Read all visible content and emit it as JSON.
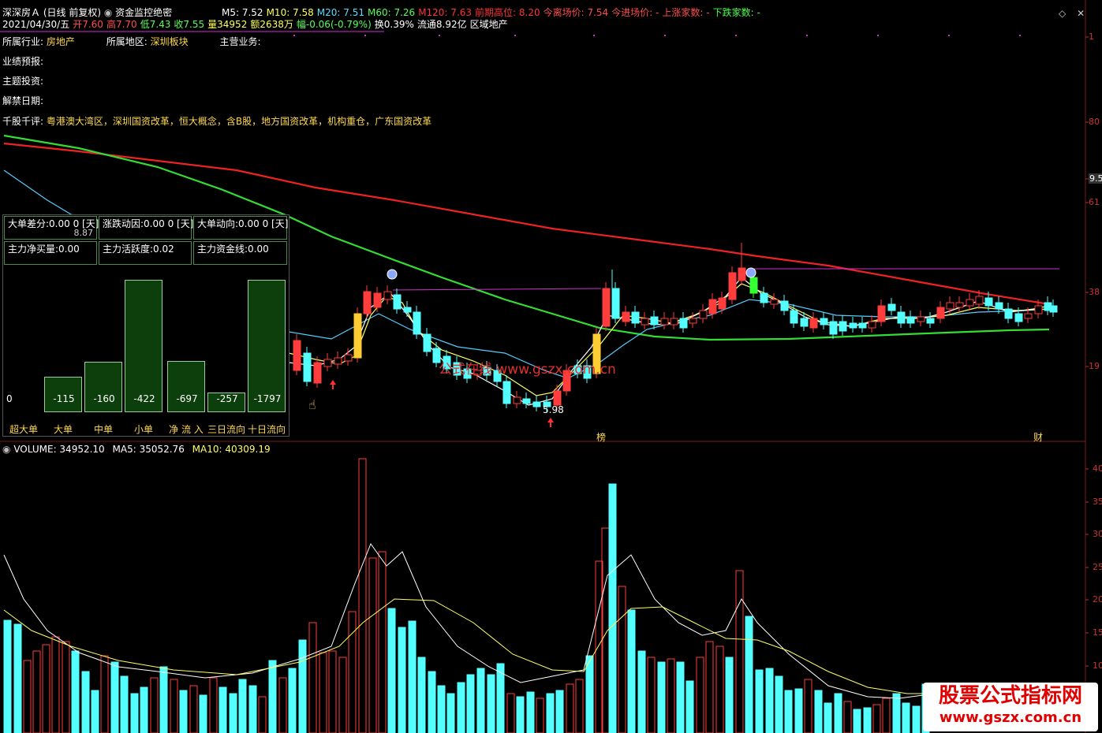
{
  "header": {
    "stock_name": "深深房Ａ",
    "mode": "(日线 前复权)",
    "indicator": "资金监控绝密",
    "ma": [
      {
        "label": "M5: 7.52",
        "color": "#ffffff"
      },
      {
        "label": "M10: 7.58",
        "color": "#ffff55"
      },
      {
        "label": "M20: 7.51",
        "color": "#55ddff"
      },
      {
        "label": "M60: 7.26",
        "color": "#55ff55"
      },
      {
        "label": "M120: 7.63",
        "color": "#ff3333"
      },
      {
        "label": "前期高位: 8.20",
        "color": "#ff3333"
      },
      {
        "label": "今离场价: 7.54",
        "color": "#ff4d4d"
      },
      {
        "label": "今进场价: -",
        "color": "#ff4d4d"
      },
      {
        "label": "上涨家数: -",
        "color": "#ff4d4d"
      },
      {
        "label": "下跌家数: -",
        "color": "#44ff44"
      }
    ],
    "quote": [
      {
        "label": "2021/04/30/五",
        "color": "#ffffff"
      },
      {
        "label": "开7.60",
        "color": "#ff4d4d"
      },
      {
        "label": "高7.70",
        "color": "#ff4d4d"
      },
      {
        "label": "低7.43",
        "color": "#55ff55"
      },
      {
        "label": "收7.55",
        "color": "#55ff55"
      },
      {
        "label": "量34952",
        "color": "#ffff55"
      },
      {
        "label": "额2638万",
        "color": "#ffff55"
      },
      {
        "label": "幅-0.06(-0.79%)",
        "color": "#55ff55"
      },
      {
        "label": "换0.39%",
        "color": "#ffffff"
      },
      {
        "label": "流通8.92亿",
        "color": "#ffffff"
      },
      {
        "label": "区域地产",
        "color": "#ffffff"
      }
    ]
  },
  "info": {
    "industry_label": "所属行业:",
    "industry": "房地产",
    "region_label": "所属地区:",
    "region": "深圳板块",
    "business_label": "主营业务:",
    "forecast_label": "业绩预报:",
    "theme_label": "主题投资:",
    "unlock_label": "解禁日期:",
    "comment_label": "千股千评:",
    "comment": "粤港澳大湾区，深圳国资改革，恒大概念，含B股，地方国资改革，机构重仓，广东国资改革"
  },
  "panel": {
    "cells": [
      "大单差分:0.00    0 [天]",
      "涨跌动因:0.00  0 [天]",
      "大单动向:0.00   0 [天]",
      "主力净买量:0.00",
      "主力活跃度:0.02",
      "主力资金线:0.00"
    ],
    "price_note": "8.87",
    "bars": [
      {
        "label": "超大单",
        "value": "0",
        "height": 0
      },
      {
        "label": "大单",
        "value": "-115",
        "height": 45
      },
      {
        "label": "中单",
        "value": "-160",
        "height": 64
      },
      {
        "label": "小单",
        "value": "-422",
        "height": 168
      },
      {
        "label": "净 流 入",
        "value": "-697",
        "height": 65
      },
      {
        "label": "三日流向",
        "value": "-257",
        "height": 25
      },
      {
        "label": "十日流向",
        "value": "-1797",
        "height": 168
      }
    ]
  },
  "chart_annotations": {
    "low_label": "5.98",
    "tag_bang": "榜",
    "tag_cai": "财"
  },
  "right_axis": {
    "top": [
      "1",
      "80",
      "9.51",
      "61",
      "38",
      "19"
    ],
    "bottom": [
      "40",
      "35",
      "30",
      "25",
      "20",
      "15",
      "10"
    ]
  },
  "volume": {
    "label": "VOLUME: 34952.10",
    "ma5": "MA5: 35052.76",
    "ma10": "MA10: 40309.19"
  },
  "watermark": {
    "top_text": "公式在线  www.gszx.com.cn",
    "box_line1": "股票公式指标网",
    "box_line2": "www.gszx.com.cn"
  },
  "colors": {
    "up": "#ff3d3d",
    "down": "#54ffff",
    "ma5": "#ffffff",
    "ma10": "#ffff66",
    "ma20": "#55ccff",
    "ma60": "#33dd33",
    "ma120": "#ee2222"
  }
}
